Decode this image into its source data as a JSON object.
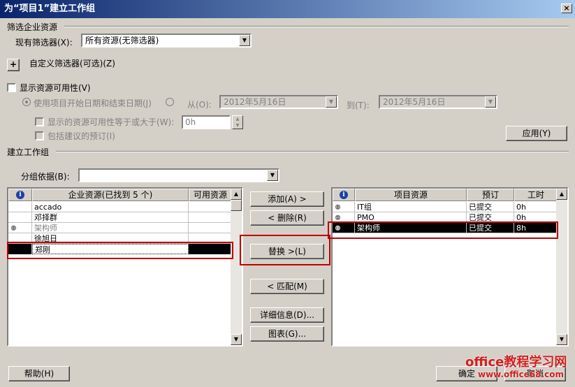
{
  "window": {
    "title": "为“项目1”建立工作组",
    "close": "×"
  },
  "filter_section": {
    "heading": "筛选企业资源",
    "existing_filter_label": "现有筛选器(X):",
    "existing_filter_value": "所有资源(无筛选器)",
    "custom_filter_label": "自定义筛选器(可选)(Z)",
    "plus": "+"
  },
  "availability": {
    "show_label": "显示资源可用性(V)",
    "use_dates_label": "使用项目开始日期和结束日期(J)",
    "from_label": "从(O):",
    "from_value": "2012年5月16日",
    "to_label": "到(T):",
    "to_value": "2012年5月16日",
    "avail_ge_label": "显示的资源可用性等于或大于(W):",
    "avail_value": "0h",
    "include_proposed_label": "包括建议的预订(I)",
    "apply_button": "应用(Y)"
  },
  "team_section": {
    "heading": "建立工作组",
    "group_by_label": "分组依据(B):",
    "group_by_value": ""
  },
  "enterprise_grid": {
    "headers": {
      "info": "i",
      "name": "企业资源(已找到 5 个)",
      "available": "可用资源"
    },
    "rows": [
      {
        "name": "accado",
        "icon": false,
        "gray": false,
        "selected": false
      },
      {
        "name": "邓择群",
        "icon": false,
        "gray": false,
        "selected": false
      },
      {
        "name": "架构师",
        "icon": true,
        "gray": true,
        "selected": false
      },
      {
        "name": "徐旭日",
        "icon": false,
        "gray": false,
        "selected": false
      },
      {
        "name": "郑刚",
        "icon": false,
        "gray": false,
        "selected": true
      }
    ]
  },
  "middle_buttons": {
    "add": "添加(A) >",
    "remove": "< 删除(R)",
    "replace": "替换 >(L)",
    "match": "< 匹配(M)",
    "details": "详细信息(D)...",
    "graphs": "图表(G)..."
  },
  "project_grid": {
    "headers": {
      "info": "i",
      "name": "项目资源",
      "booking": "预订",
      "work": "工时"
    },
    "rows": [
      {
        "name": "IT组",
        "booking": "已提交",
        "work": "0h",
        "selected": false
      },
      {
        "name": "PMO",
        "booking": "已提交",
        "work": "0h",
        "selected": false
      },
      {
        "name": "架构师",
        "booking": "已提交",
        "work": "8h",
        "selected": true
      }
    ]
  },
  "footer": {
    "help": "帮助(H)",
    "ok": "确定",
    "cancel": "取消",
    "watermark_top": "office教程学习网",
    "watermark_bottom": "www.office68.com"
  },
  "colors": {
    "highlight_red": "#c00000",
    "title_start": "#0a246a",
    "title_end": "#a6caf0",
    "info_blue": "#1c3fae"
  },
  "icons": [
    "info-icon",
    "resource-generic-icon",
    "dropdown-arrow-icon",
    "scroll-up-icon",
    "scroll-down-icon",
    "close-icon",
    "expand-plus-icon"
  ]
}
